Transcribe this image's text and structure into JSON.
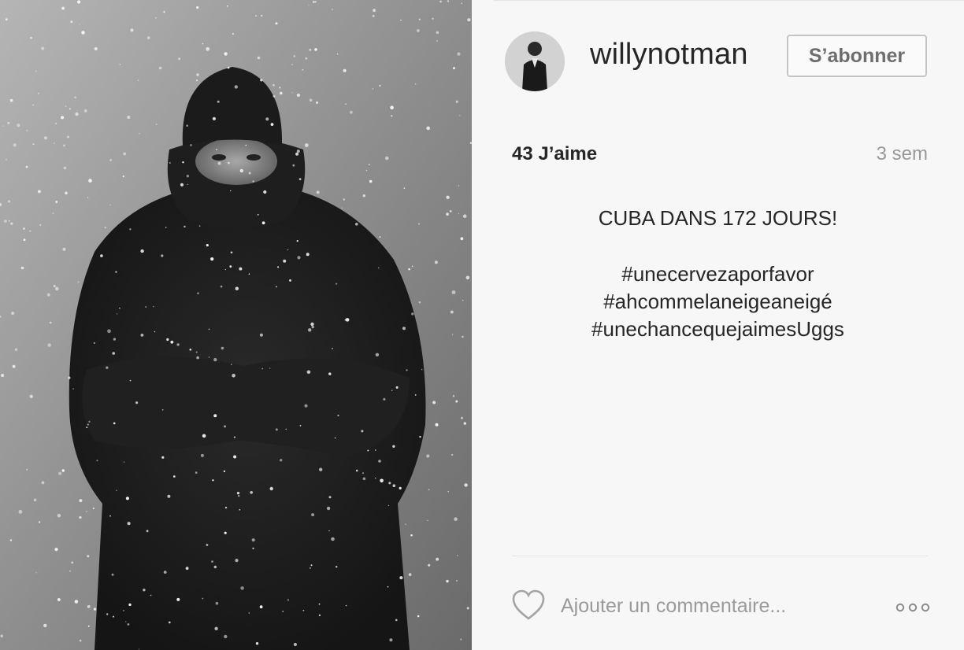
{
  "post": {
    "photo_icon": "winter-fur-coat-photo",
    "photo_description": "",
    "colors": {
      "panel_bg": "#f7f7f7",
      "text": "#262626",
      "muted": "#999999",
      "button_border": "#c4c4c4"
    }
  },
  "header": {
    "avatar_icon": "profile-avatar",
    "username": "willynotman",
    "follow_label": "S’abonner"
  },
  "stats": {
    "likes": "43 J’aime",
    "age": "3 sem"
  },
  "caption": {
    "title": "CUBA DANS 172 JOURS!",
    "hashtags": [
      "#unecervezaporfavor",
      "#ahcommelaneigeaneigé",
      "#unechancequejaimesUggs"
    ]
  },
  "footer": {
    "like_icon": "heart-icon",
    "comment_placeholder": "Ajouter un commentaire...",
    "more_icon": "more-options-icon"
  }
}
